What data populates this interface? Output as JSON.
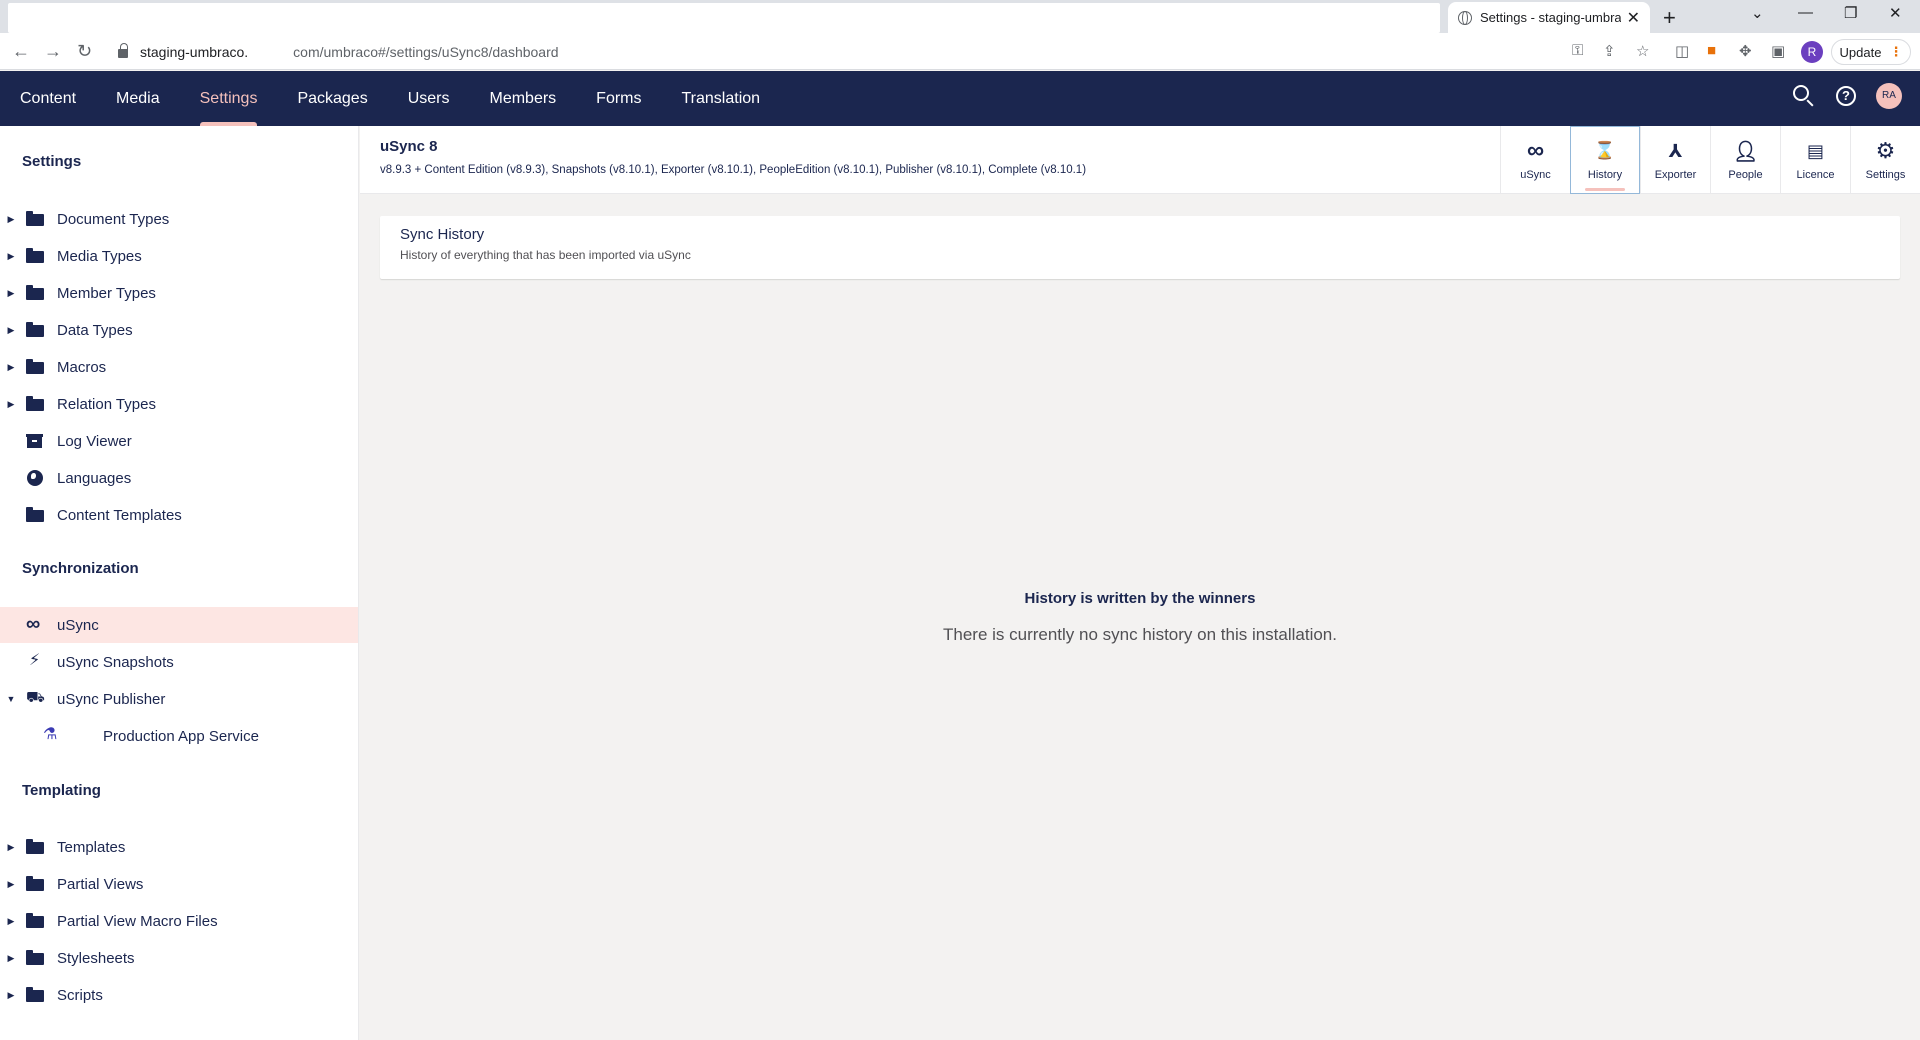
{
  "browser": {
    "tab_title": "Settings - staging-umbrac",
    "tab_close": "✕",
    "new_tab": "+",
    "url_host": "staging-umbraco.",
    "url_path": "com/umbraco#/settings/uSync8/dashboard",
    "profile_initial": "R",
    "update_label": "Update"
  },
  "header": {
    "sections": [
      "Content",
      "Media",
      "Settings",
      "Packages",
      "Users",
      "Members",
      "Forms",
      "Translation"
    ],
    "active_section": "Settings",
    "user_initials": "RA"
  },
  "sidebar": {
    "groups": [
      {
        "title": "Settings",
        "items": [
          {
            "label": "Document Types",
            "icon": "folder-icon",
            "expandable": true
          },
          {
            "label": "Media Types",
            "icon": "folder-icon",
            "expandable": true
          },
          {
            "label": "Member Types",
            "icon": "folder-icon",
            "expandable": true
          },
          {
            "label": "Data Types",
            "icon": "folder-icon",
            "expandable": true
          },
          {
            "label": "Macros",
            "icon": "folder-icon",
            "expandable": true
          },
          {
            "label": "Relation Types",
            "icon": "folder-icon",
            "expandable": true
          },
          {
            "label": "Log Viewer",
            "icon": "archive-icon",
            "expandable": false
          },
          {
            "label": "Languages",
            "icon": "globe-icon",
            "expandable": false
          },
          {
            "label": "Content Templates",
            "icon": "folder-icon",
            "expandable": false
          }
        ]
      },
      {
        "title": "Synchronization",
        "items": [
          {
            "label": "uSync",
            "icon": "infinity-icon",
            "expandable": false,
            "active": true
          },
          {
            "label": "uSync Snapshots",
            "icon": "lightning-icon",
            "expandable": false
          },
          {
            "label": "uSync Publisher",
            "icon": "truck-icon",
            "expandable": true,
            "expanded": true
          },
          {
            "label": "Production App Service",
            "icon": "flask-icon",
            "expandable": false,
            "child": true
          }
        ]
      },
      {
        "title": "Templating",
        "items": [
          {
            "label": "Templates",
            "icon": "folder-icon",
            "expandable": true
          },
          {
            "label": "Partial Views",
            "icon": "folder-icon",
            "expandable": true
          },
          {
            "label": "Partial View Macro Files",
            "icon": "folder-icon",
            "expandable": true
          },
          {
            "label": "Stylesheets",
            "icon": "folder-icon",
            "expandable": true
          },
          {
            "label": "Scripts",
            "icon": "folder-icon",
            "expandable": true
          }
        ]
      }
    ]
  },
  "dashboard": {
    "name": "uSync 8",
    "versions": "v8.9.3 + Content Edition (v8.9.3), Snapshots (v8.10.1), Exporter (v8.10.1), PeopleEdition (v8.10.1), Publisher (v8.10.1), Complete (v8.10.1)",
    "apps": [
      {
        "label": "uSync",
        "icon": "infinity-icon"
      },
      {
        "label": "History",
        "icon": "hourglass-icon",
        "active": true
      },
      {
        "label": "Exporter",
        "icon": "network-icon"
      },
      {
        "label": "People",
        "icon": "person-icon"
      },
      {
        "label": "Licence",
        "icon": "certificate-icon"
      },
      {
        "label": "Settings",
        "icon": "gear-icon"
      }
    ],
    "box_title": "Sync History",
    "box_subtitle": "History of everything that has been imported via uSync",
    "empty_title": "History is written by the winners",
    "empty_text": "There is currently no sync history on this installation."
  },
  "colors": {
    "header_bg": "#1b264f",
    "accent": "#f5c1bc",
    "active_item_bg": "#fde6e3"
  }
}
